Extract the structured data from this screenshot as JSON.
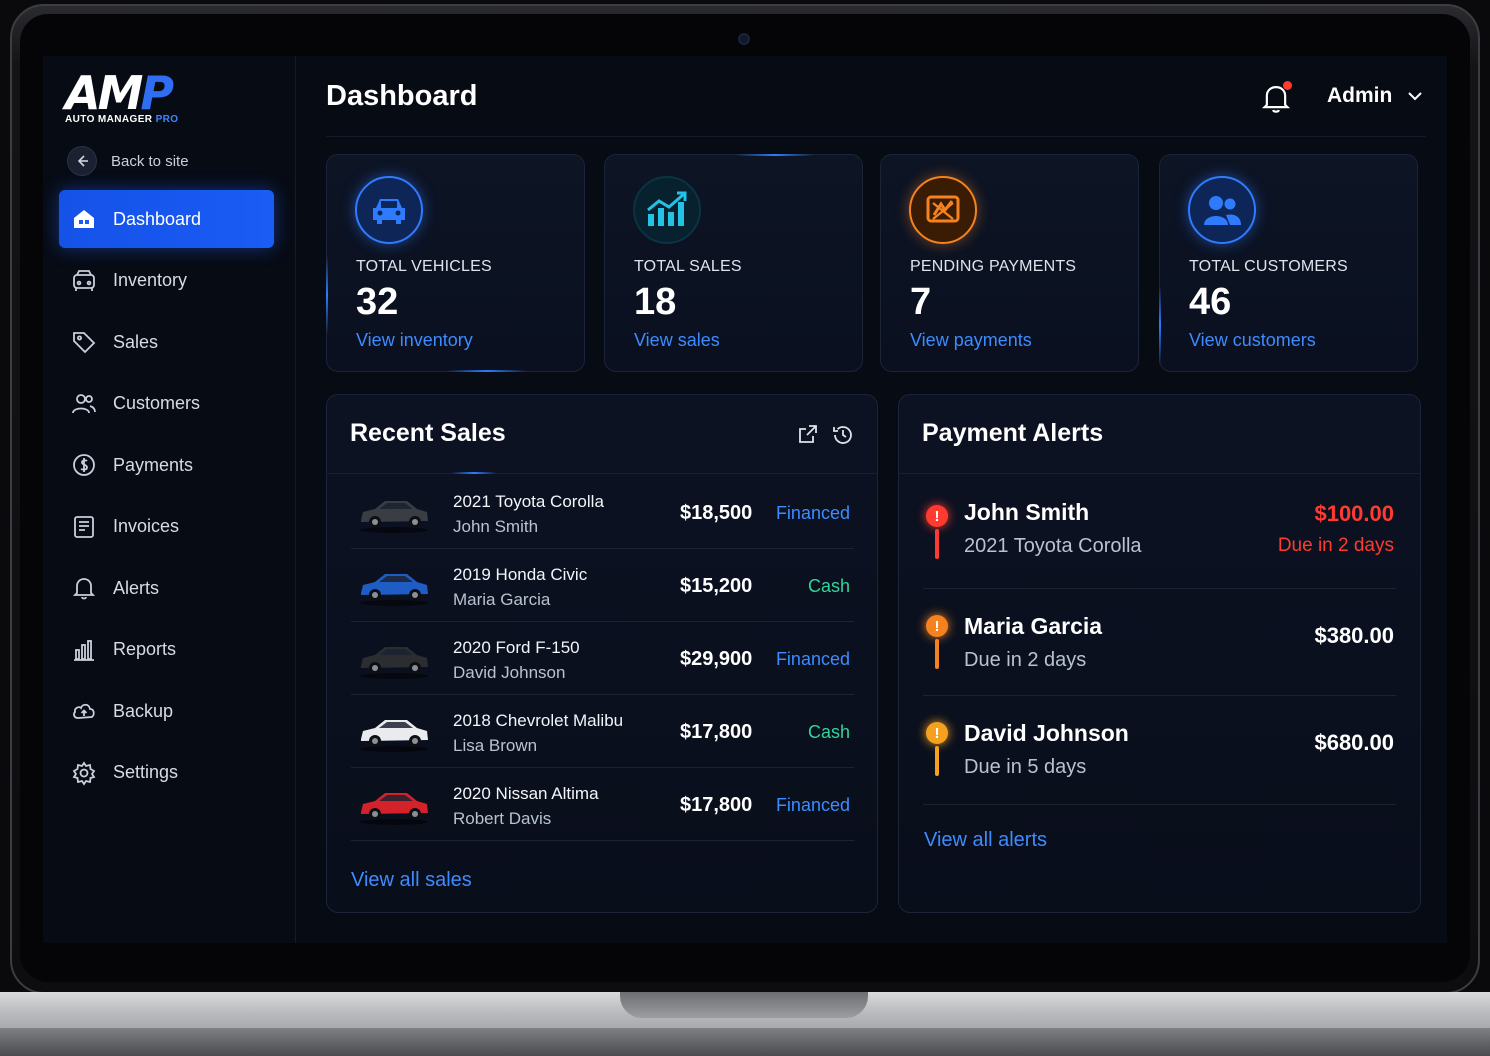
{
  "app": {
    "logo_text": "AMP",
    "logo_subtitle": "AUTO MANAGER",
    "logo_subtitle_accent": "PRO"
  },
  "sidebar": {
    "back_label": "Back to site",
    "items": [
      {
        "label": "Dashboard",
        "icon": "dashboard-icon",
        "active": true
      },
      {
        "label": "Inventory",
        "icon": "car-icon"
      },
      {
        "label": "Sales",
        "icon": "tag-icon"
      },
      {
        "label": "Customers",
        "icon": "users-icon"
      },
      {
        "label": "Payments",
        "icon": "dollar-icon"
      },
      {
        "label": "Invoices",
        "icon": "invoice-icon"
      },
      {
        "label": "Alerts",
        "icon": "bell-icon"
      },
      {
        "label": "Reports",
        "icon": "chart-icon"
      },
      {
        "label": "Backup",
        "icon": "cloud-icon"
      },
      {
        "label": "Settings",
        "icon": "gear-icon"
      }
    ]
  },
  "header": {
    "title": "Dashboard",
    "user": "Admin"
  },
  "stats": [
    {
      "label": "TOTAL VEHICLES",
      "value": "32",
      "link": "View inventory",
      "icon": "car-icon",
      "color": "#2f7bff"
    },
    {
      "label": "TOTAL SALES",
      "value": "18",
      "link": "View sales",
      "icon": "growth-chart-icon",
      "color": "#22c3e6"
    },
    {
      "label": "PENDING PAYMENTS",
      "value": "7",
      "link": "View payments",
      "icon": "payment-alert-icon",
      "color": "#f5821f"
    },
    {
      "label": "TOTAL CUSTOMERS",
      "value": "46",
      "link": "View customers",
      "icon": "users-icon",
      "color": "#2f7bff"
    }
  ],
  "recent_sales": {
    "title": "Recent Sales",
    "view_all": "View all sales",
    "rows": [
      {
        "model": "2021 Toyota Corolla",
        "customer": "John Smith",
        "price": "$18,500",
        "status": "Financed",
        "car_color": "#3a3d44"
      },
      {
        "model": "2019 Honda Civic",
        "customer": "Maria Garcia",
        "price": "$15,200",
        "status": "Cash",
        "car_color": "#1f5cc4"
      },
      {
        "model": "2020 Ford F-150",
        "customer": "David Johnson",
        "price": "$29,900",
        "status": "Financed",
        "car_color": "#2b2d31"
      },
      {
        "model": "2018 Chevrolet Malibu",
        "customer": "Lisa Brown",
        "price": "$17,800",
        "status": "Cash",
        "car_color": "#e9ebef"
      },
      {
        "model": "2020 Nissan Altima",
        "customer": "Robert Davis",
        "price": "$17,800",
        "status": "Financed",
        "car_color": "#d3222a"
      }
    ]
  },
  "payment_alerts": {
    "title": "Payment Alerts",
    "view_all": "View all alerts",
    "rows": [
      {
        "name": "John Smith",
        "sub": "2021 Toyota Corolla",
        "amount": "$100.00",
        "due": "Due in 2 days",
        "severity": "high",
        "color": "#ff3b30"
      },
      {
        "name": "Maria Garcia",
        "sub": "Due in 2 days",
        "amount": "$380.00",
        "due": "",
        "severity": "medium",
        "color": "#f5821f"
      },
      {
        "name": "David Johnson",
        "sub": "Due in 5 days",
        "amount": "$680.00",
        "due": "",
        "severity": "medium",
        "color": "#f5a11f"
      }
    ]
  },
  "colors": {
    "accent": "#1a5cf5",
    "link": "#3d8bff",
    "success": "#34d399",
    "danger": "#ff3b30",
    "warning": "#f5821f"
  }
}
